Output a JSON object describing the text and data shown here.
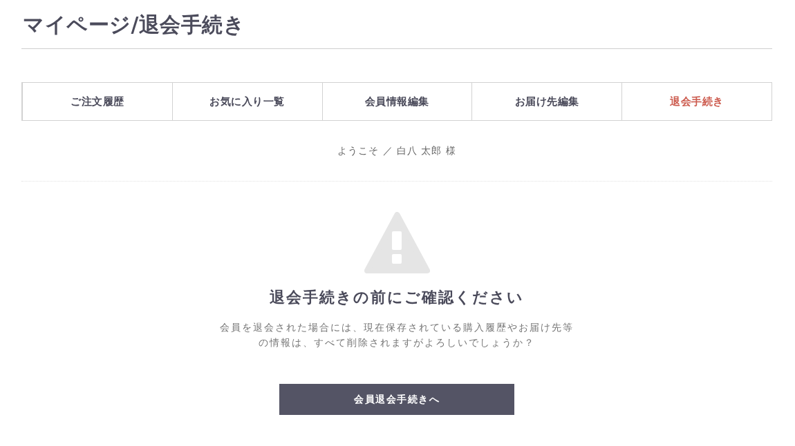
{
  "page_title": "マイページ/退会手続き",
  "tabs": [
    {
      "label": "ご注文履歴",
      "selected": false
    },
    {
      "label": "お気に入り一覧",
      "selected": false
    },
    {
      "label": "会員情報編集",
      "selected": false
    },
    {
      "label": "お届け先編集",
      "selected": false
    },
    {
      "label": "退会手続き",
      "selected": true
    }
  ],
  "welcome": "ようこそ ／ 白八 太郎 様",
  "notice": {
    "heading": "退会手続きの前にご確認ください",
    "message": "会員を退会された場合には、現在保存されている購入履歴やお届け先等の情報は、すべて削除されますがよろしいでしょうか？",
    "button": "会員退会手続きへ"
  }
}
